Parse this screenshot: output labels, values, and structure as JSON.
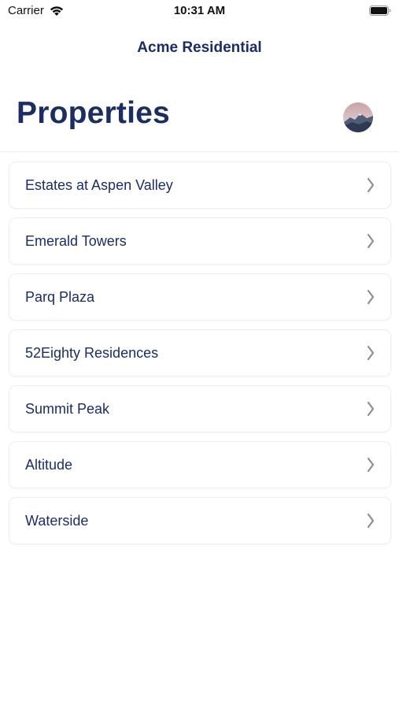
{
  "status_bar": {
    "carrier": "Carrier",
    "time": "10:31 AM"
  },
  "nav": {
    "title": "Acme Residential"
  },
  "header": {
    "title": "Properties"
  },
  "properties": [
    {
      "label": "Estates at Aspen Valley"
    },
    {
      "label": "Emerald Towers"
    },
    {
      "label": "Parq Plaza"
    },
    {
      "label": "52Eighty Residences"
    },
    {
      "label": "Summit Peak"
    },
    {
      "label": "Altitude"
    },
    {
      "label": "Waterside"
    }
  ],
  "colors": {
    "brand_navy": "#1c2d63",
    "chevron": "#8e8e93"
  },
  "icons": {
    "status": [
      "wifi-icon",
      "battery-icon"
    ],
    "list_item": "chevron-right-icon",
    "profile": "avatar"
  }
}
